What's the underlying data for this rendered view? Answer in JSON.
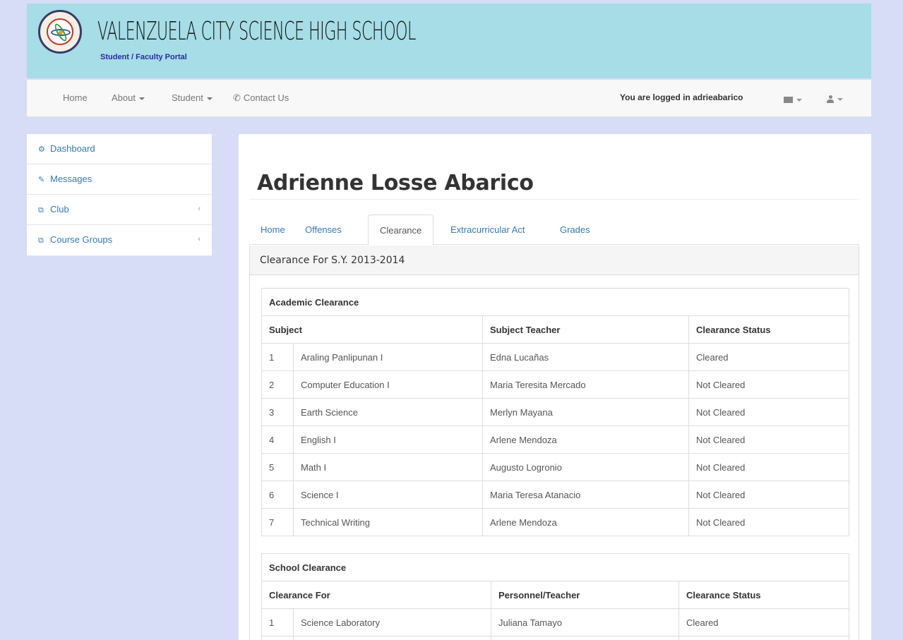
{
  "header": {
    "school_name": "VALENZUELA CITY SCIENCE HIGH SCHOOL",
    "portal_label": "Student / Faculty Portal"
  },
  "navbar": {
    "items": [
      {
        "label": "Home"
      },
      {
        "label": "About"
      },
      {
        "label": "Student"
      },
      {
        "label": "Contact Us",
        "icon": "phone-icon"
      }
    ],
    "user_status": "You are logged in adrieabarico",
    "messages_icon": "envelope-icon",
    "user_icon": "user-icon"
  },
  "sidebar": {
    "items": [
      {
        "label": "Dashboard",
        "icon": "dashboard-icon"
      },
      {
        "label": "Messages",
        "icon": "edit-icon"
      },
      {
        "label": "Club",
        "icon": "copy-icon"
      },
      {
        "label": "Course Groups",
        "icon": "copy-icon"
      }
    ]
  },
  "main": {
    "page_title": "Adrienne Losse Abarico",
    "tabs": [
      {
        "label": "Home"
      },
      {
        "label": "Offenses"
      },
      {
        "label": "Clearance"
      },
      {
        "label": "Extracurricular Act"
      },
      {
        "label": "Grades"
      }
    ],
    "active_tab": "Clearance",
    "panel_heading": "Clearance For S.Y. 2013-2014",
    "academic": {
      "caption": "Academic Clearance",
      "headers": [
        "Subject",
        "Subject Teacher",
        "Clearance Status"
      ],
      "rows": [
        {
          "no": "1",
          "subject": "Araling Panlipunan I",
          "teacher": "Edna Lucañas",
          "status": "Cleared"
        },
        {
          "no": "2",
          "subject": "Computer Education I",
          "teacher": "Maria Teresita Mercado",
          "status": "Not Cleared"
        },
        {
          "no": "3",
          "subject": "Earth Science",
          "teacher": "Merlyn Mayana",
          "status": "Not Cleared"
        },
        {
          "no": "4",
          "subject": "English I",
          "teacher": "Arlene Mendoza",
          "status": "Not Cleared"
        },
        {
          "no": "5",
          "subject": "Math I",
          "teacher": "Augusto Logronio",
          "status": "Not Cleared"
        },
        {
          "no": "6",
          "subject": "Science I",
          "teacher": "Maria Teresa Atanacio",
          "status": "Not Cleared"
        },
        {
          "no": "7",
          "subject": "Technical Writing",
          "teacher": "Arlene Mendoza",
          "status": "Not Cleared"
        }
      ]
    },
    "school": {
      "caption": "School Clearance",
      "headers": [
        "Clearance For",
        "Personnel/Teacher",
        "Clearance Status"
      ],
      "rows": [
        {
          "no": "1",
          "subject": "Science Laboratory",
          "teacher": "Juliana Tamayo",
          "status": "Cleared"
        }
      ]
    }
  }
}
